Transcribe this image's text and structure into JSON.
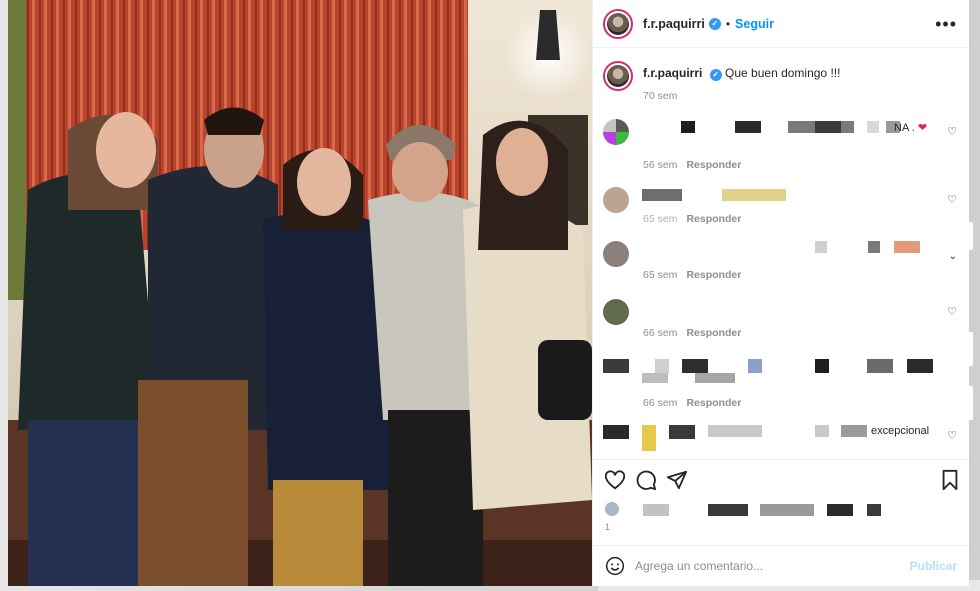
{
  "post": {
    "username": "f.r.paquirri",
    "verified_icon": "verified-badge-icon",
    "follow_label": "Seguir",
    "more_icon": "more-options-icon",
    "caption": "Que buen domingo !!!",
    "caption_time": "70 sem"
  },
  "comments": [
    {
      "fragment": "NA . ",
      "emoji": "❤",
      "time": "56 sem",
      "reply": "Responder"
    },
    {
      "time": "65 sem",
      "reply": "Responder"
    },
    {
      "time": "65 sem",
      "reply": "Responder"
    },
    {
      "time": "66 sem",
      "reply": "Responder"
    },
    {
      "time": "66 sem",
      "reply": "Responder"
    },
    {
      "fragment": "excepcional"
    }
  ],
  "actions": {
    "like_icon": "heart-icon",
    "comment_icon": "comment-icon",
    "share_icon": "share-icon",
    "save_icon": "bookmark-icon"
  },
  "likes_counter": "1",
  "composer": {
    "emoji_icon": "emoji-icon",
    "placeholder": "Agrega un comentario...",
    "publish_label": "Publicar"
  },
  "colors": {
    "link_blue": "#0095f6",
    "publish_disabled": "#b2dffc",
    "muted_text": "#8e8e8e",
    "heart_red": "#e0245e"
  }
}
